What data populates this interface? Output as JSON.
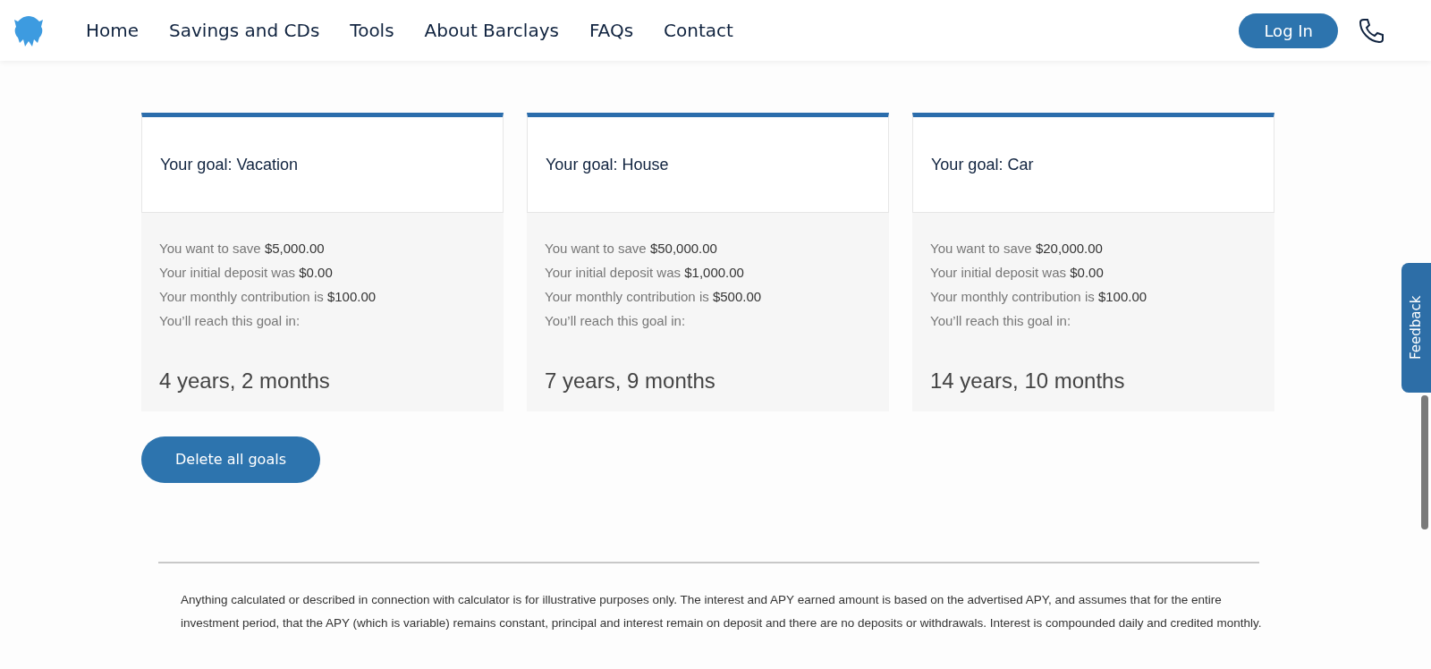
{
  "nav": {
    "items": [
      "Home",
      "Savings and CDs",
      "Tools",
      "About Barclays",
      "FAQs",
      "Contact"
    ],
    "login": "Log In"
  },
  "goals": [
    {
      "title": "Your goal: Vacation",
      "lines": [
        "You want to save **$5,000.00**",
        "Your initial deposit was **$0.00**",
        "Your monthly contribution is **$100.00**",
        "You’ll reach this goal in:"
      ],
      "result": "4 years, 2 months"
    },
    {
      "title": "Your goal: House",
      "lines": [
        "You want to save **$50,000.00**",
        "Your initial deposit was **$1,000.00**",
        "Your monthly contribution is **$500.00**",
        "You’ll reach this goal in:"
      ],
      "result": "7 years, 9 months"
    },
    {
      "title": "Your goal: Car",
      "lines": [
        "You want to save **$20,000.00**",
        "Your initial deposit was **$0.00**",
        "Your monthly contribution is **$100.00**",
        "You’ll reach this goal in:"
      ],
      "result": "14 years, 10 months"
    }
  ],
  "delete_button": "Delete all goals",
  "disclaimer": "Anything calculated or described in connection with calculator is for illustrative purposes only. The interest and APY earned amount is based on the advertised APY, and assumes that for the entire investment period, that the APY (which is variable) remains constant, principal and interest remain on deposit and there are no deposits or withdrawals. Interest is compounded daily and credited monthly.",
  "feedback_tab": "Feedback"
}
